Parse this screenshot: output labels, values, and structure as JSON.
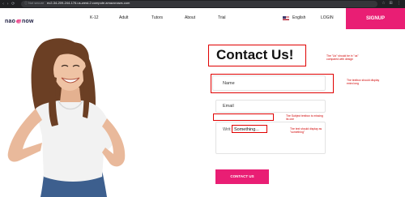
{
  "browser": {
    "nav_glyphs": "‹ › ⟳",
    "info_glyph": "ⓘ",
    "security": "Not secure",
    "url": "ec2-34-209-244-176.us-west-2.compute.amazonaws.com"
  },
  "header": {
    "logo_left": "nao",
    "logo_right": "now",
    "menu": [
      "K-12",
      "Adult",
      "Tutors",
      "About",
      "Trial"
    ],
    "language": "English",
    "login": "LOGIN",
    "signup": "SIGNUP"
  },
  "form": {
    "title": "Contact Us!",
    "name_placeholder": "Name",
    "email_placeholder": "Email",
    "message_prefix": "Writ",
    "message_overlay": "Something...",
    "submit": "CONTACT US"
  },
  "notes": {
    "title_note": "The \"Us\" should be in \"us\" compared with design",
    "name_note": "The textbox should display extra long",
    "subject_note": "The Subject textbox is missing its one",
    "message_note": "The text should display as \"something\""
  },
  "colors": {
    "brand_pink": "#e91e74",
    "annotation_red": "#e00000",
    "chrome_dark": "#202124"
  }
}
